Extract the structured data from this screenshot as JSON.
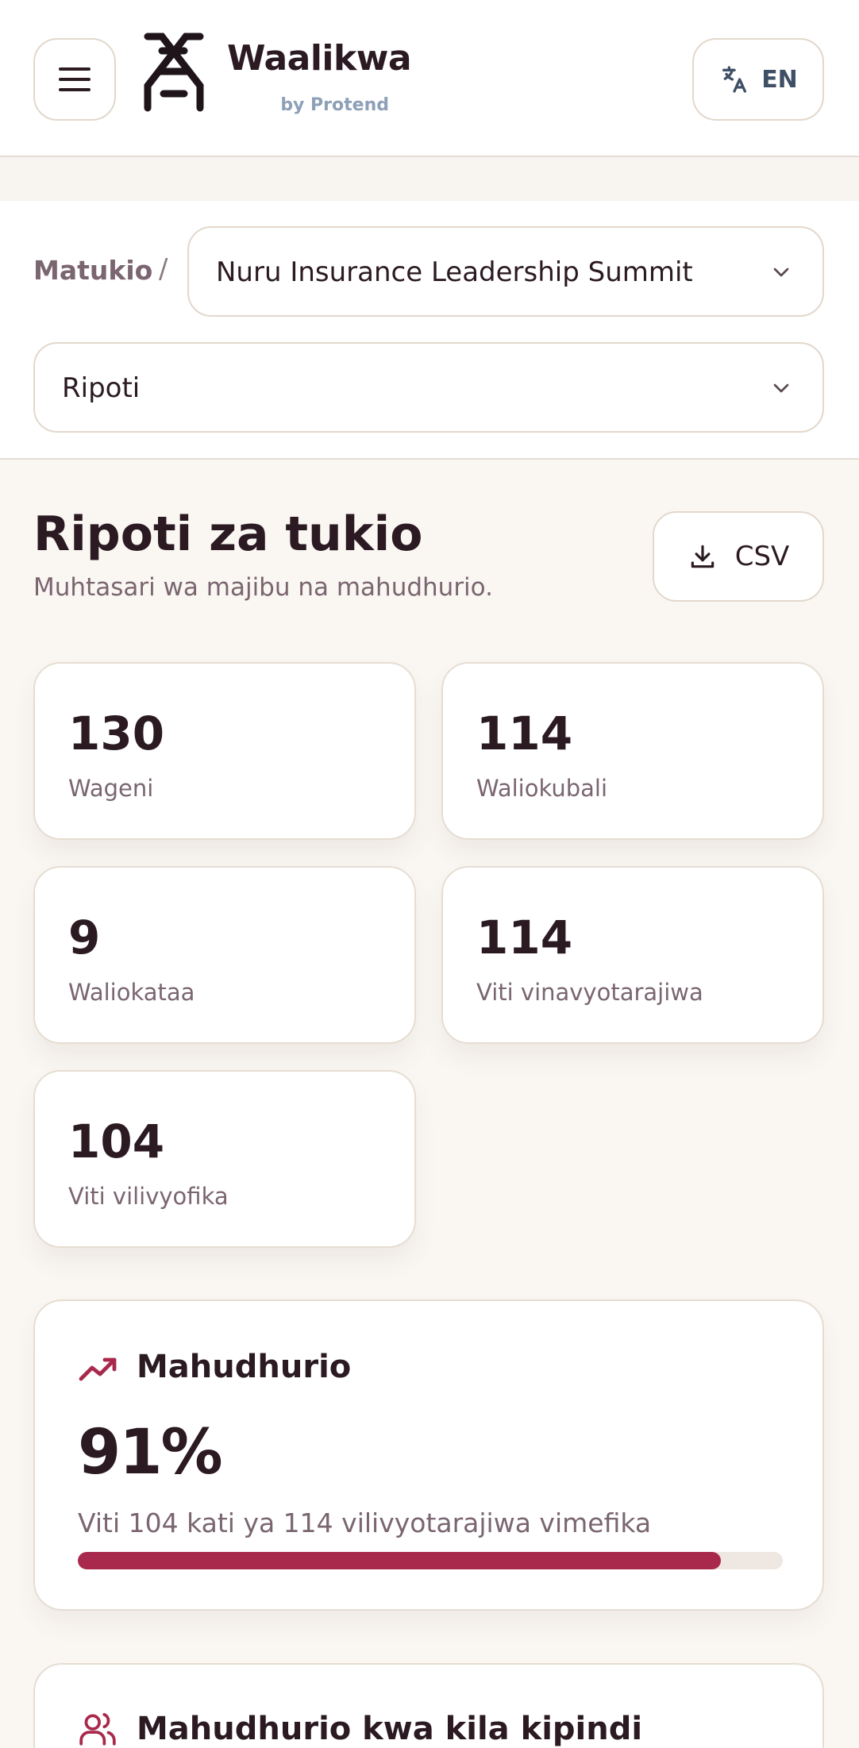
{
  "header": {
    "brand_name": "Waalikwa",
    "brand_sub": "by Protend",
    "language_label": "EN",
    "icons": {
      "menu": "menu-icon",
      "logo": "waalikwa-logo",
      "language": "translate-icon"
    }
  },
  "breadcrumb": {
    "root_label": "Matukio",
    "separator": "/",
    "event_selected": "Nuru Insurance Leadership Summit"
  },
  "view_select": {
    "selected": "Ripoti"
  },
  "page": {
    "title": "Ripoti za tukio",
    "subtitle": "Muhtasari wa majibu na mahudhurio.",
    "export_label": "CSV"
  },
  "stats": [
    {
      "value": "130",
      "label": "Wageni"
    },
    {
      "value": "114",
      "label": "Waliokubali"
    },
    {
      "value": "9",
      "label": "Waliokataa"
    },
    {
      "value": "114",
      "label": "Viti vinavyotarajiwa"
    },
    {
      "value": "104",
      "label": "Viti vilivyofika"
    }
  ],
  "attendance": {
    "title": "Mahudhurio",
    "percent_text": "91%",
    "description": "Viti 104 kati ya 114 vilivyotarajiwa vimefika",
    "progress_fraction": 0.912,
    "accent_color": "#a8294b"
  },
  "sessions": {
    "title": "Mahudhurio kwa kila kipindi"
  },
  "colors": {
    "text": "#2b1a22",
    "muted": "#7a6570",
    "accent": "#a8294b",
    "background": "#faf7f3"
  }
}
